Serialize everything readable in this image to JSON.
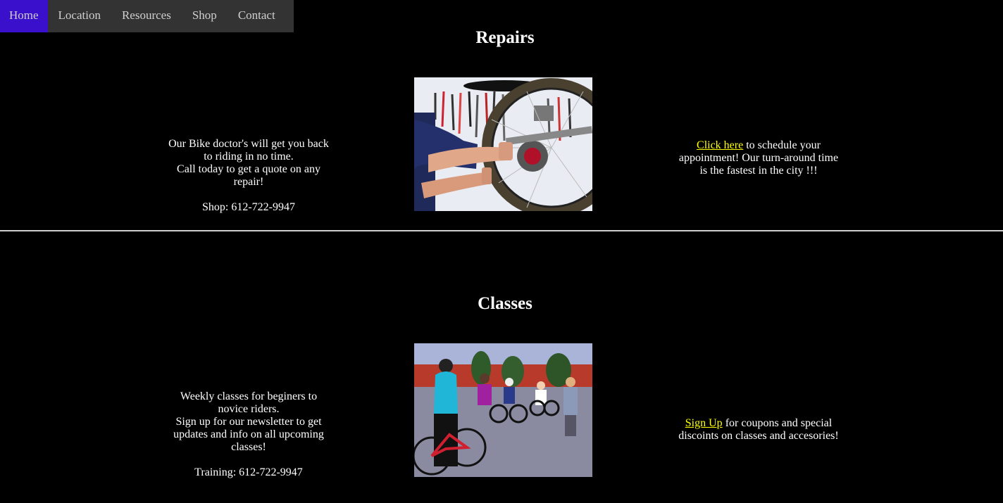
{
  "nav": {
    "items": [
      {
        "label": "Home"
      },
      {
        "label": "Location"
      },
      {
        "label": "Resources"
      },
      {
        "label": "Shop"
      },
      {
        "label": "Contact"
      }
    ],
    "colors": {
      "bar": "#333333",
      "active": "#3a10cc",
      "text": "#cfcfcf"
    }
  },
  "repairs": {
    "title": "Repairs",
    "left": {
      "line1": "Our Bike doctor's will get you back to riding in no time.",
      "line2": "Call today to get a quote on any repair!",
      "phone": "Shop: 612-722-9947"
    },
    "right": {
      "link": "Click here",
      "text": " to schedule your appointment! Our turn-around time is the fastest in the city !!!"
    },
    "image_alt": "Mechanic repairing a bicycle wheel in front of a tool wall"
  },
  "classes": {
    "title": "Classes",
    "left": {
      "line1": "Weekly classes for beginers to novice riders.",
      "line2": "Sign up for our newsletter to get updates and info on all upcoming classes!",
      "phone": "Training: 612-722-9947"
    },
    "right": {
      "link": "Sign Up",
      "text": " for coupons and special discoints on classes and accesories!"
    },
    "image_alt": "Group of cyclists with bikes in a parking lot during a class"
  },
  "colors": {
    "background": "#000000",
    "text": "#ffffff",
    "link": "#ffff00",
    "divider": "#cfcfcf"
  }
}
